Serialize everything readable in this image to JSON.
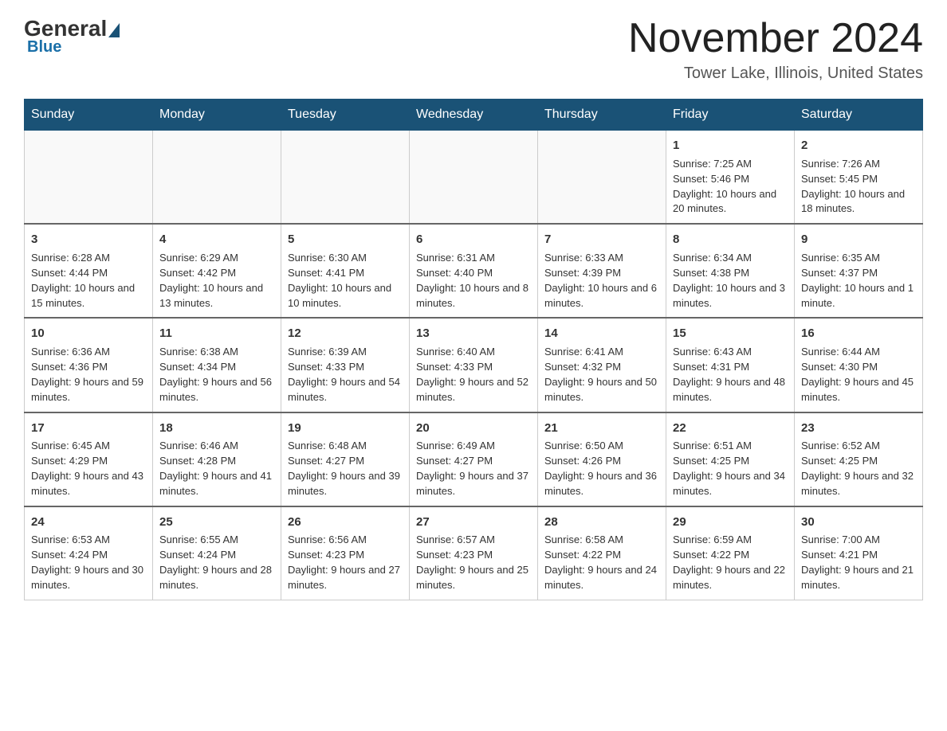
{
  "logo": {
    "general": "General",
    "blue": "Blue"
  },
  "header": {
    "month": "November 2024",
    "location": "Tower Lake, Illinois, United States"
  },
  "days_of_week": [
    "Sunday",
    "Monday",
    "Tuesday",
    "Wednesday",
    "Thursday",
    "Friday",
    "Saturday"
  ],
  "weeks": [
    [
      {
        "num": "",
        "info": ""
      },
      {
        "num": "",
        "info": ""
      },
      {
        "num": "",
        "info": ""
      },
      {
        "num": "",
        "info": ""
      },
      {
        "num": "",
        "info": ""
      },
      {
        "num": "1",
        "info": "Sunrise: 7:25 AM\nSunset: 5:46 PM\nDaylight: 10 hours and 20 minutes."
      },
      {
        "num": "2",
        "info": "Sunrise: 7:26 AM\nSunset: 5:45 PM\nDaylight: 10 hours and 18 minutes."
      }
    ],
    [
      {
        "num": "3",
        "info": "Sunrise: 6:28 AM\nSunset: 4:44 PM\nDaylight: 10 hours and 15 minutes."
      },
      {
        "num": "4",
        "info": "Sunrise: 6:29 AM\nSunset: 4:42 PM\nDaylight: 10 hours and 13 minutes."
      },
      {
        "num": "5",
        "info": "Sunrise: 6:30 AM\nSunset: 4:41 PM\nDaylight: 10 hours and 10 minutes."
      },
      {
        "num": "6",
        "info": "Sunrise: 6:31 AM\nSunset: 4:40 PM\nDaylight: 10 hours and 8 minutes."
      },
      {
        "num": "7",
        "info": "Sunrise: 6:33 AM\nSunset: 4:39 PM\nDaylight: 10 hours and 6 minutes."
      },
      {
        "num": "8",
        "info": "Sunrise: 6:34 AM\nSunset: 4:38 PM\nDaylight: 10 hours and 3 minutes."
      },
      {
        "num": "9",
        "info": "Sunrise: 6:35 AM\nSunset: 4:37 PM\nDaylight: 10 hours and 1 minute."
      }
    ],
    [
      {
        "num": "10",
        "info": "Sunrise: 6:36 AM\nSunset: 4:36 PM\nDaylight: 9 hours and 59 minutes."
      },
      {
        "num": "11",
        "info": "Sunrise: 6:38 AM\nSunset: 4:34 PM\nDaylight: 9 hours and 56 minutes."
      },
      {
        "num": "12",
        "info": "Sunrise: 6:39 AM\nSunset: 4:33 PM\nDaylight: 9 hours and 54 minutes."
      },
      {
        "num": "13",
        "info": "Sunrise: 6:40 AM\nSunset: 4:33 PM\nDaylight: 9 hours and 52 minutes."
      },
      {
        "num": "14",
        "info": "Sunrise: 6:41 AM\nSunset: 4:32 PM\nDaylight: 9 hours and 50 minutes."
      },
      {
        "num": "15",
        "info": "Sunrise: 6:43 AM\nSunset: 4:31 PM\nDaylight: 9 hours and 48 minutes."
      },
      {
        "num": "16",
        "info": "Sunrise: 6:44 AM\nSunset: 4:30 PM\nDaylight: 9 hours and 45 minutes."
      }
    ],
    [
      {
        "num": "17",
        "info": "Sunrise: 6:45 AM\nSunset: 4:29 PM\nDaylight: 9 hours and 43 minutes."
      },
      {
        "num": "18",
        "info": "Sunrise: 6:46 AM\nSunset: 4:28 PM\nDaylight: 9 hours and 41 minutes."
      },
      {
        "num": "19",
        "info": "Sunrise: 6:48 AM\nSunset: 4:27 PM\nDaylight: 9 hours and 39 minutes."
      },
      {
        "num": "20",
        "info": "Sunrise: 6:49 AM\nSunset: 4:27 PM\nDaylight: 9 hours and 37 minutes."
      },
      {
        "num": "21",
        "info": "Sunrise: 6:50 AM\nSunset: 4:26 PM\nDaylight: 9 hours and 36 minutes."
      },
      {
        "num": "22",
        "info": "Sunrise: 6:51 AM\nSunset: 4:25 PM\nDaylight: 9 hours and 34 minutes."
      },
      {
        "num": "23",
        "info": "Sunrise: 6:52 AM\nSunset: 4:25 PM\nDaylight: 9 hours and 32 minutes."
      }
    ],
    [
      {
        "num": "24",
        "info": "Sunrise: 6:53 AM\nSunset: 4:24 PM\nDaylight: 9 hours and 30 minutes."
      },
      {
        "num": "25",
        "info": "Sunrise: 6:55 AM\nSunset: 4:24 PM\nDaylight: 9 hours and 28 minutes."
      },
      {
        "num": "26",
        "info": "Sunrise: 6:56 AM\nSunset: 4:23 PM\nDaylight: 9 hours and 27 minutes."
      },
      {
        "num": "27",
        "info": "Sunrise: 6:57 AM\nSunset: 4:23 PM\nDaylight: 9 hours and 25 minutes."
      },
      {
        "num": "28",
        "info": "Sunrise: 6:58 AM\nSunset: 4:22 PM\nDaylight: 9 hours and 24 minutes."
      },
      {
        "num": "29",
        "info": "Sunrise: 6:59 AM\nSunset: 4:22 PM\nDaylight: 9 hours and 22 minutes."
      },
      {
        "num": "30",
        "info": "Sunrise: 7:00 AM\nSunset: 4:21 PM\nDaylight: 9 hours and 21 minutes."
      }
    ]
  ]
}
